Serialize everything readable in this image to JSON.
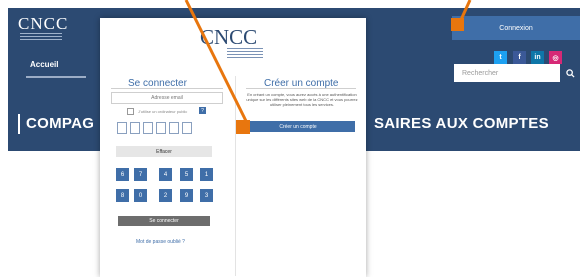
{
  "header": {
    "logo_text": "CNCC",
    "nav_home": "Accueil",
    "login_button": "Connexion",
    "social": [
      {
        "label": "t",
        "name": "twitter",
        "color": "#1da1f2"
      },
      {
        "label": "f",
        "name": "facebook",
        "color": "#3b5998"
      },
      {
        "label": "in",
        "name": "linkedin",
        "color": "#0e76a8"
      },
      {
        "label": "◎",
        "name": "instagram",
        "color": "#d62976"
      }
    ],
    "search_placeholder": "Rechercher",
    "search_icon": "search-icon",
    "banner_left": "COMPAG",
    "banner_right": "SAIRES AUX COMPTES"
  },
  "modal": {
    "logo_text": "CNCC",
    "login": {
      "title": "Se connecter",
      "email_placeholder": "Adresse email",
      "public_pc_label": "J'utilise un ordinateur public",
      "help_icon": "?",
      "clear_label": "Effacer",
      "keypad": [
        "6",
        "7",
        "4",
        "5",
        "1",
        "8",
        "0",
        "2",
        "9",
        "3"
      ],
      "submit_label": "Se connecter",
      "forgot_label": "Mot de passe oublié ?"
    },
    "create": {
      "title": "Créer un compte",
      "description": "En créant un compte, vous aurez accès à une authentification unique sur les différents sites web de la CNCC et vous pourrez utiliser pleinement tous les services.",
      "button_label": "Créer un compte"
    }
  },
  "colors": {
    "header_bg": "#2c4a72",
    "accent_blue": "#3f6ea8",
    "arrow_orange": "#e8760e"
  }
}
